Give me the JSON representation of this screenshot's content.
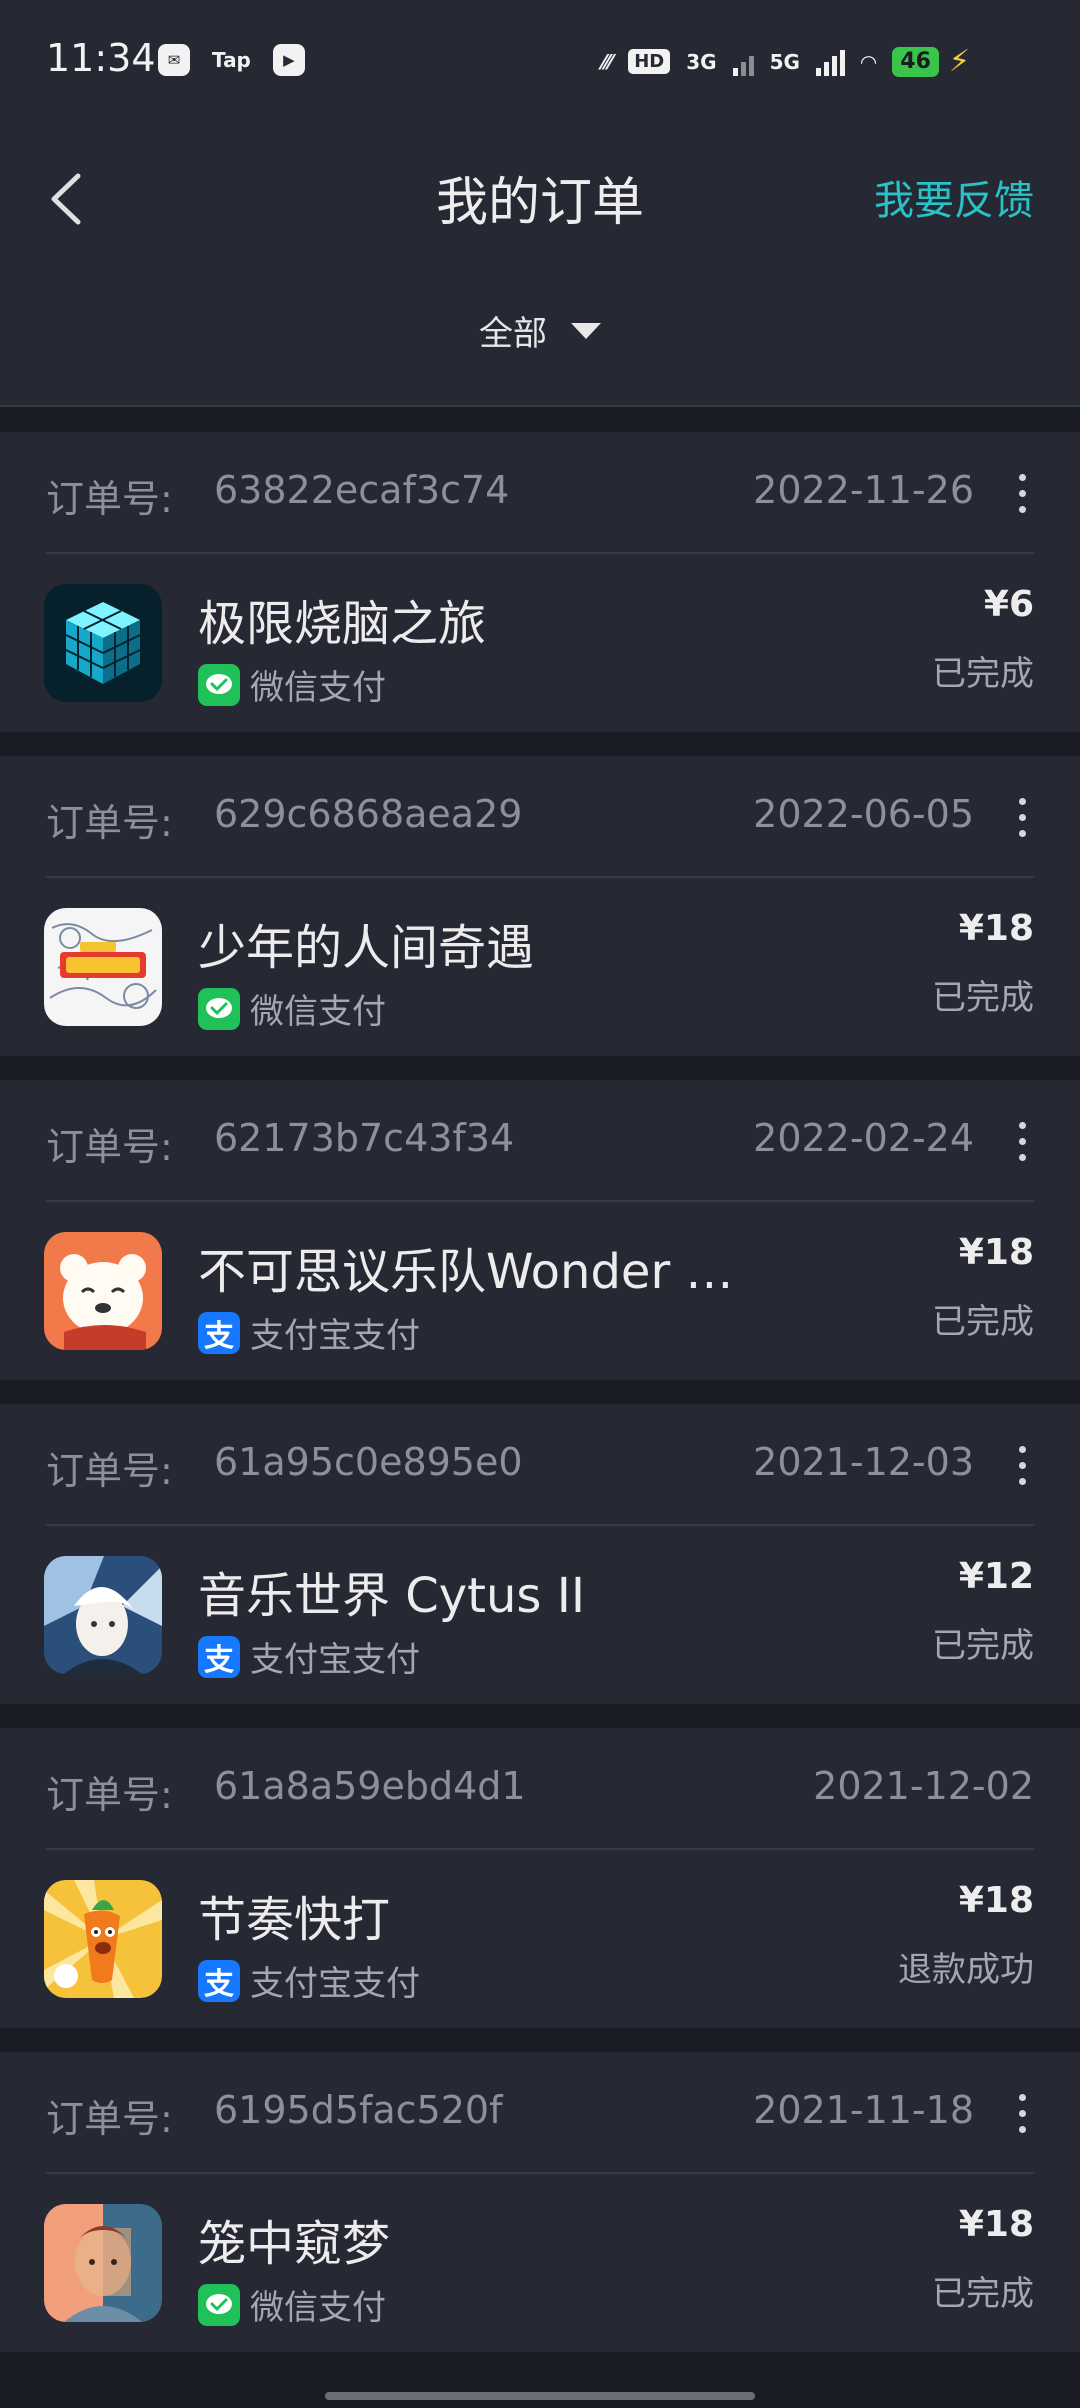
{
  "status_bar": {
    "time": "11:34",
    "app_icons": [
      "message-icon",
      "tap-icon",
      "play-icon"
    ],
    "tap_label": "Tap",
    "net_label": "3G",
    "net_label2": "5G",
    "hd_label": "HD",
    "battery": "46"
  },
  "header": {
    "title": "我的订单",
    "feedback": "我要反馈",
    "filter": "全部"
  },
  "orders": [
    {
      "no_label": "订单号:",
      "no": "63822ecaf3c74",
      "date": "2022-11-26",
      "has_menu": true,
      "app": "极限烧脑之旅",
      "pay": "微信支付",
      "pay_type": "wechat",
      "price": "¥6",
      "status": "已完成",
      "icon": "cube-game-icon"
    },
    {
      "no_label": "订单号:",
      "no": "629c6868aea29",
      "date": "2022-06-05",
      "has_menu": true,
      "app": "少年的人间奇遇",
      "pay": "微信支付",
      "pay_type": "wechat",
      "price": "¥18",
      "status": "已完成",
      "icon": "comic-game-icon"
    },
    {
      "no_label": "订单号:",
      "no": "62173b7c43f34",
      "date": "2022-02-24",
      "has_menu": true,
      "app": "不可思议乐队Wonder …",
      "pay": "支付宝支付",
      "pay_type": "alipay",
      "price": "¥18",
      "status": "已完成",
      "icon": "bear-game-icon"
    },
    {
      "no_label": "订单号:",
      "no": "61a95c0e895e0",
      "date": "2021-12-03",
      "has_menu": true,
      "app": "音乐世界 Cytus II",
      "pay": "支付宝支付",
      "pay_type": "alipay",
      "price": "¥12",
      "status": "已完成",
      "icon": "cytus-game-icon"
    },
    {
      "no_label": "订单号:",
      "no": "61a8a59ebd4d1",
      "date": "2021-12-02",
      "has_menu": false,
      "app": "节奏快打",
      "pay": "支付宝支付",
      "pay_type": "alipay",
      "price": "¥18",
      "status": "退款成功",
      "icon": "carrot-game-icon"
    },
    {
      "no_label": "订单号:",
      "no": "6195d5fac520f",
      "date": "2021-11-18",
      "has_menu": true,
      "app": "笼中窥梦",
      "pay": "微信支付",
      "pay_type": "wechat",
      "price": "¥18",
      "status": "已完成",
      "icon": "face-game-icon"
    }
  ],
  "colors": {
    "accent": "#29c2c8",
    "wechat": "#21c15a",
    "alipay": "#1677ff",
    "card": "#262833",
    "background": "#1a1c23"
  }
}
